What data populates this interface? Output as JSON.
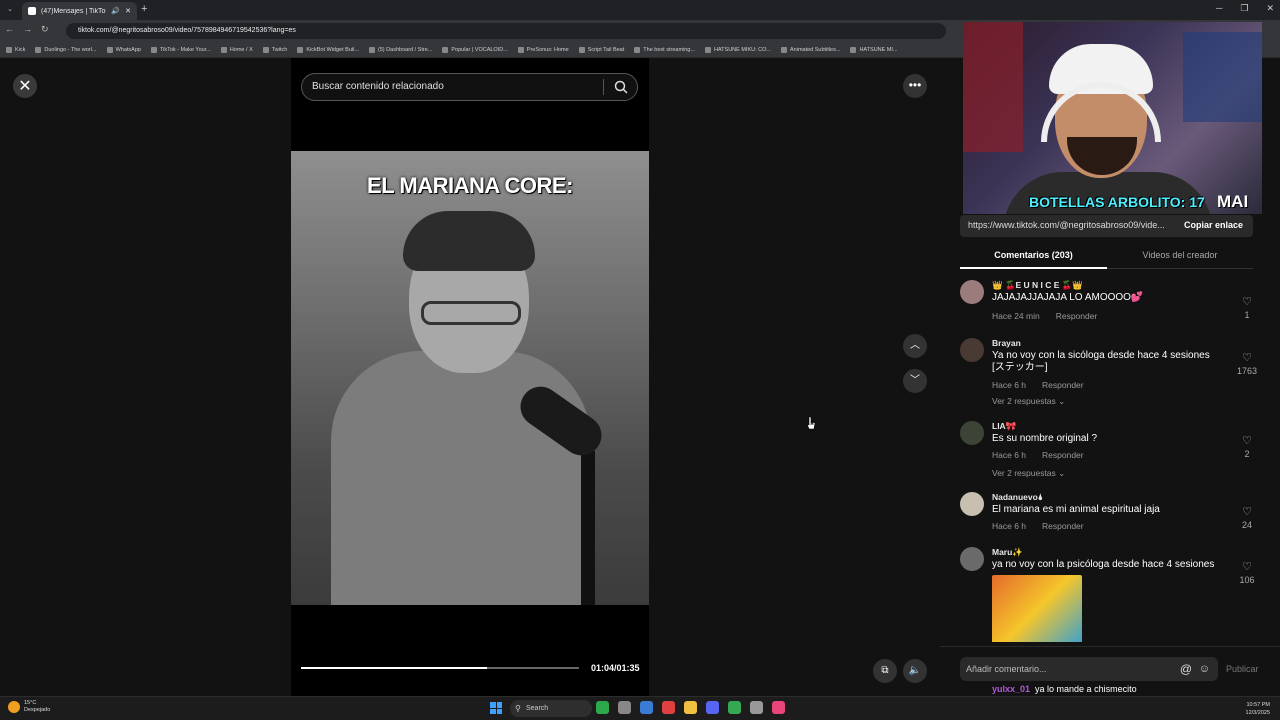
{
  "browser": {
    "tab_title": "(47)Mensajes | TikTok",
    "url": "tiktok.com/@negritosabroso09/video/7578984946719542536?lang=es",
    "bookmarks": [
      "Kick",
      "Duolingo - The worl...",
      "WhatsApp",
      "TikTok - Make Your...",
      "Home / X",
      "Twitch",
      "KickBot Widget Buil...",
      "(5) Dashboard / Stre...",
      "Popular | VOCALOID...",
      "PreSonus: Home",
      "Script Tail Beat",
      "The best streaming...",
      "HATSUNE MIKU: CO...",
      "Animated Subtitles...",
      "HATSUNE MI..."
    ]
  },
  "search": {
    "placeholder": "Buscar contenido relacionado"
  },
  "video": {
    "caption": "EL MARIANA CORE:",
    "time": "01:04/01:35",
    "progress": 0.67
  },
  "share": {
    "link": "https://www.tiktok.com/@negritosabroso09/vide...",
    "copy_label": "Copiar enlace"
  },
  "tabs": {
    "comments": "Comentarios (203)",
    "creator_videos": "Videos del creador"
  },
  "comments": [
    {
      "name": "👑 🍒E U N I C E 🍒👑",
      "text": "JAJAJAJJAJAJA LO AMOOOO💕",
      "time": "Hace 24 min",
      "reply": "Responder",
      "likes": "1",
      "replies": ""
    },
    {
      "name": "Brayan",
      "text": "Ya no voy con la sicóloga desde hace 4 sesiones [ステッカー]",
      "time": "Hace 6 h",
      "reply": "Responder",
      "likes": "1763",
      "replies": "Ver 2 respuestas ⌄"
    },
    {
      "name": "LIA🎀",
      "text": "Es su nombre original ?",
      "time": "Hace 6 h",
      "reply": "Responder",
      "likes": "2",
      "replies": "Ver 2 respuestas ⌄"
    },
    {
      "name": "Nadanuevo🌢",
      "text": "El mariana es mi animal espiritual jaja",
      "time": "Hace 6 h",
      "reply": "Responder",
      "likes": "24",
      "replies": ""
    },
    {
      "name": "Maru✨",
      "text": "ya no voy con la psicóloga desde hace 4 sesiones",
      "time": "",
      "reply": "",
      "likes": "106",
      "replies": ""
    }
  ],
  "add_comment": {
    "placeholder": "Añadir comentario...",
    "publish": "Publicar"
  },
  "chat": {
    "user": "yulxx_01",
    "message": "ya lo mande a chismecito"
  },
  "webcam": {
    "overlay_text": "BOTELLAS ARBOLITO: 17",
    "overlay_text2": "MAI"
  },
  "taskbar": {
    "weather_temp": "15°C",
    "weather_desc": "Despejado",
    "search": "Search",
    "time": "10:57 PM",
    "date": "12/3/2025"
  }
}
